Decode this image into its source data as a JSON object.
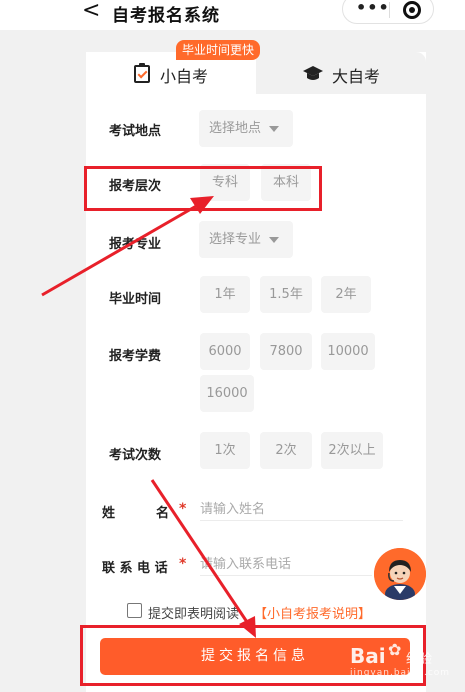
{
  "header": {
    "back_glyph": "<",
    "title": "自考报名系统",
    "menu_glyph": "•••"
  },
  "tabs": {
    "active": "小自考",
    "inactive": "大自考",
    "badge": "毕业时间更快",
    "active_icon": "clipboard-check-icon",
    "inactive_icon": "graduation-cap-icon"
  },
  "form": {
    "location": {
      "label": "考试地点",
      "placeholder": "选择地点"
    },
    "level": {
      "label": "报考层次",
      "options": [
        "专科",
        "本科"
      ]
    },
    "major": {
      "label": "报考专业",
      "placeholder": "选择专业"
    },
    "graduation": {
      "label": "毕业时间",
      "options": [
        "1年",
        "1.5年",
        "2年"
      ]
    },
    "fee": {
      "label": "报考学费",
      "options": [
        "6000",
        "7800",
        "10000",
        "16000"
      ]
    },
    "attempts": {
      "label": "考试次数",
      "options": [
        "1次",
        "2次",
        "2次以上"
      ]
    },
    "name": {
      "label_chars": [
        "姓",
        "名"
      ],
      "required": "*",
      "placeholder": "请输入姓名"
    },
    "phone": {
      "label": "联 系 电 话",
      "required": "*",
      "placeholder": "请输入联系电话"
    },
    "agreement": {
      "text": "提交即表明阅读",
      "link": "【小自考报考说明】"
    },
    "submit_label": "提交报名信息"
  },
  "watermark": {
    "brand": "Bai",
    "word": "经验",
    "url": "jingyan.baidu.com"
  },
  "colors": {
    "accent": "#ff5c2a",
    "annotation": "#e8202a"
  }
}
